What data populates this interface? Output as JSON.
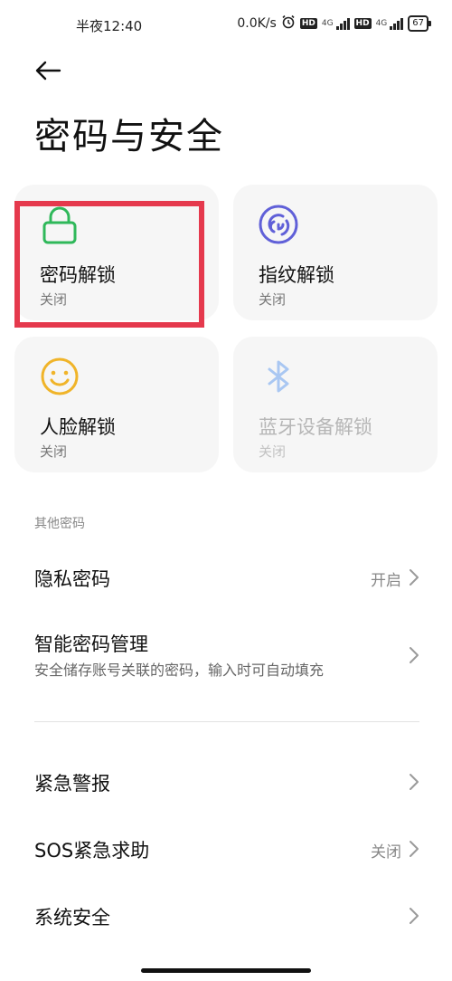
{
  "status_bar": {
    "time": "半夜12:40",
    "network_speed": "0.0K/s",
    "hd_badge": "HD",
    "network_type": "4G",
    "battery": "67"
  },
  "page_title": "密码与安全",
  "tiles": [
    {
      "label": "密码解锁",
      "status": "关闭",
      "icon": "lock-icon",
      "color": "#2fb85a"
    },
    {
      "label": "指纹解锁",
      "status": "关闭",
      "icon": "fingerprint-icon",
      "color": "#6060d8"
    },
    {
      "label": "人脸解锁",
      "status": "关闭",
      "icon": "smiley-face-icon",
      "color": "#f0b429"
    },
    {
      "label": "蓝牙设备解锁",
      "status": "关闭",
      "icon": "bluetooth-icon",
      "color": "#a9c7f2",
      "disabled": true
    }
  ],
  "section_other_passwords": "其他密码",
  "rows": {
    "privacy_password": {
      "title": "隐私密码",
      "value": "开启"
    },
    "smart_password": {
      "title": "智能密码管理",
      "subtitle": "安全储存账号关联的密码，输入时可自动填充"
    },
    "emergency_alert": {
      "title": "紧急警报"
    },
    "sos": {
      "title": "SOS紧急求助",
      "value": "关闭"
    },
    "system_security": {
      "title": "系统安全"
    }
  },
  "colors": {
    "highlight": "#e5394d",
    "tile_bg": "#f6f6f6"
  }
}
